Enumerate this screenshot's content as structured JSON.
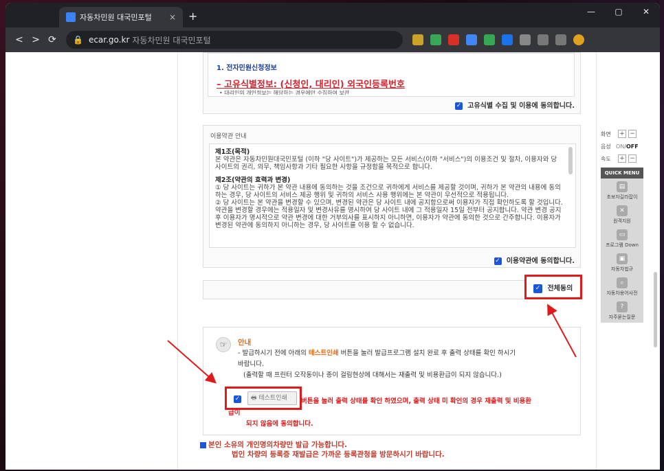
{
  "browser": {
    "tab_title": "자동차민원 대국민포털",
    "tab_close": "×",
    "new_tab": "+",
    "url_domain": "ecar.go.kr",
    "url_title": "자동차민원 대국민포털",
    "win_min": "—",
    "win_max": "▢",
    "win_close": "✕",
    "nav_back": "<",
    "nav_forward": ">",
    "nav_reload": "⟳"
  },
  "unique_info": {
    "section": "1. 전자민원신청정보",
    "link": "– 고유식별정보: (신청인, 대리인) 외국인등록번호",
    "subnote": "• 대리인의 개인정보는 해당하는 경우에만 수집하여 보관",
    "agree_label": "고유식별 수집 및 이용에 동의합니다."
  },
  "terms": {
    "title": "이용약관 안내",
    "a1_title": "제1조(목적)",
    "a1_body": "   본 약관은 자동차민원대국민포털 (이하 \"당 사이트\")가 제공하는 모든 서비스(이하 \"서비스\")의 이용조건 및 절차, 이용자와 당 사이트의 권리, 의무, 책임사항과 기타 필요한 사항을 규정함을 목적으로 합니다.",
    "a2_title": "제2조(약관의 효력과 변경)",
    "a2_p1": "   ① 당 사이트는 귀하가 본 약관 내용에 동의하는 것을 조건으로 귀하에게 서비스를 제공할 것이며, 귀하가 본 약관의 내용에 동의하는 경우, 당 사이트의 서비스 제공 행위 및 귀하의 서비스 사용 행위에는 본 약관이 우선적으로 적용됩니다.",
    "a2_p2": "   ② 당 사이트는 본 약관을 변경할 수 있으며, 변경된 약관은 당 사이트 내에 공지함으로써 이용자가 직접 확인하도록 할 것입니다. 약관을 변경할 경우에는 적용일자 및 변경사유를 명시하여 당 사이트 내에 그 적용일자 15일 전부터 공지합니다. 약관 변경 공지 후 이용자가 명시적으로 약관 변경에 대한 거부의사를 표시하지 아니하면, 이용자가 약관에 동의한 것으로 간주합니다. 이용자가 변경된 약관에 동의하지 아니하는 경우, 당 사이트를 이용 할 수 없습니다.",
    "agree_label": "이용약관에 동의합니다."
  },
  "all_agree": "전체동의",
  "notice": {
    "title": "안내",
    "line1_pre": "- 발급하시기 전에 아래의 ",
    "line1_em": "테스트인쇄",
    "line1_post": " 버튼을 눌러 발급프로그램 설치 완료 후 출력 상태를 확인 하시기",
    "line2": "바랍니다.",
    "line3": "(출력할 때 프린터 오작동이나 종이 걸림현상에 대해서는 재출력 및 비용환급이 되지 않습니다.)",
    "test_print_label": "테스트인쇄",
    "confirm_text_1": "버튼을 눌러 출력 상태를 확인 하였으며, 출력 상태 미 확인의 경우 재출력 및 비용환",
    "confirm_text_2": "급이",
    "confirm_text_3": "되지 않음에 동의합니다."
  },
  "bottom": {
    "line1": "본인 소유의 개인명의차량만 발급 가능합니다.",
    "line2": "법인 차량의 등록증 재발급은 가까운 등록관청을 방문하시기 바랍니다."
  },
  "quick": {
    "zoom_label": "화면",
    "voice_label": "음성",
    "voice_on": "ON",
    "voice_sep": "/",
    "voice_off": "OFF",
    "speed_label": "속도",
    "plus": "+",
    "minus": "−",
    "menu_title": "QUICK MENU",
    "items": [
      "초보자길라잡이",
      "원격지원",
      "프로그램 Down",
      "자동차법규",
      "자동차용어사전",
      "자주묻는질문"
    ]
  },
  "colors": {
    "accent_red": "#e01a1a",
    "checkbox_blue": "#1a56db",
    "title_blue": "#1a3c9a",
    "orange_emph": "#e86b1a"
  }
}
